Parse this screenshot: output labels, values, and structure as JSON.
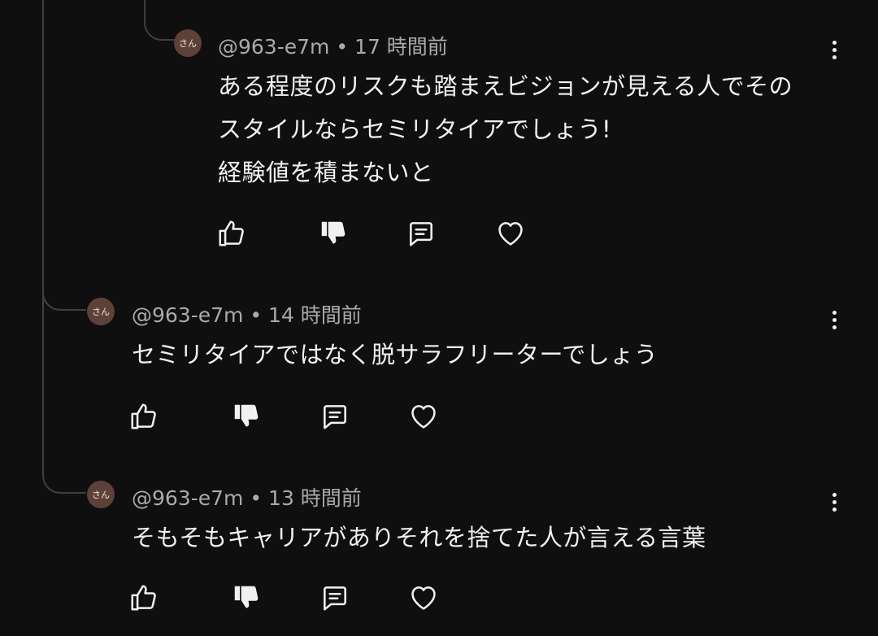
{
  "comments": [
    {
      "avatar_text": "さん",
      "handle": "@963-e7m",
      "separator": "•",
      "time": "17 時間前",
      "text": "ある程度のリスクも踏まえビジョンが見える人でその\nスタイルならセミリタイアでしょう!\n経験値を積まないと"
    },
    {
      "avatar_text": "さん",
      "handle": "@963-e7m",
      "separator": "•",
      "time": "14 時間前",
      "text": "セミリタイアではなく脱サラフリーターでしょう"
    },
    {
      "avatar_text": "さん",
      "handle": "@963-e7m",
      "separator": "•",
      "time": "13 時間前",
      "text": "そもそもキャリアがありそれを捨てた人が言える言葉"
    }
  ],
  "icons": {
    "like": "thumb-up-icon",
    "dislike": "thumb-down-icon",
    "reply": "reply-icon",
    "heart": "heart-icon",
    "more": "more-vertical-icon"
  },
  "colors": {
    "background": "#0f0f0f",
    "text": "#f1f1f1",
    "meta": "#aaaaaa",
    "avatar": "#5d4037",
    "thread_line": "#3f3f3f"
  }
}
